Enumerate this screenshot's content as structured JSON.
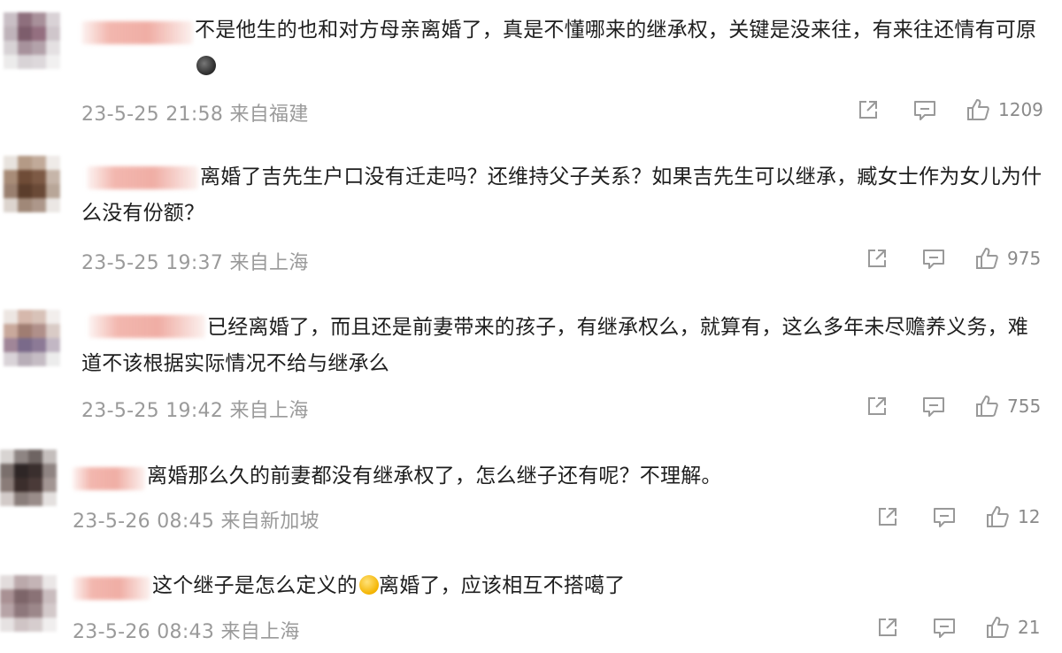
{
  "comments": [
    {
      "text": "不是他生的也和对方母亲离婚了，真是不懂哪来的继承权，关键是没来往，有来往还情有可原",
      "emoji": "dark",
      "time": "23-5-25 21:58",
      "location": "来自福建",
      "likes": "1209",
      "avatar": [
        "#c9bfc5",
        "#8e6f7d",
        "#a8909a",
        "#d9d2d6",
        "#bfb3ba",
        "#7d5d6c",
        "#946f80",
        "#cfc6cb",
        "#d7d2d5",
        "#a7929c",
        "#b3a2aa",
        "#e4e0e2",
        "#ecebeb",
        "#d8d3d6",
        "#ddd8db",
        "#f1f0f0"
      ]
    },
    {
      "text": "离婚了吉先生户口没有迁走吗？还维持父子关系？如果吉先生可以继承，臧女士作为女儿为什么没有份额？",
      "emoji": "",
      "time": "23-5-25 19:37",
      "location": "来自上海",
      "likes": "975",
      "avatar": [
        "#e8e3de",
        "#b49a86",
        "#c1aa99",
        "#efebe8",
        "#a88c78",
        "#6f4c37",
        "#7d5a45",
        "#c6b5a9",
        "#9a8070",
        "#5b3d2c",
        "#6a4a37",
        "#b8a698",
        "#dcd4ce",
        "#a08878",
        "#ad978a",
        "#ebe7e4"
      ]
    },
    {
      "text": "已经离婚了，而且还是前妻带来的孩子，有继承权么，就算有，这么多年未尽赡养义务，难道不该根据实际情况不给与继承么",
      "emoji": "",
      "time": "23-5-25 19:42",
      "location": "来自上海",
      "likes": "755",
      "avatar": [
        "#ede6e2",
        "#d6b8ac",
        "#d8c2b8",
        "#f2eeec",
        "#c9a99c",
        "#a07d72",
        "#b0908a",
        "#d9cbc6",
        "#a08698",
        "#7a6a8a",
        "#8c7a96",
        "#c2b7c4",
        "#d9d3d8",
        "#b8aeb8",
        "#c5bcc4",
        "#ececec"
      ]
    },
    {
      "text": "离婚那么久的前妻都没有继承权了，怎么继子还有呢？不理解。",
      "emoji": "",
      "time": "23-5-26 08:45",
      "location": "来自新加坡",
      "likes": "12",
      "avatar": [
        "#d8d4d2",
        "#8e8583",
        "#6e6462",
        "#c4bebc",
        "#7a6f6c",
        "#2e2626",
        "#3a2f2e",
        "#8f8482",
        "#8a7c78",
        "#3b2e2c",
        "#4a3a38",
        "#a29592",
        "#d2cac8",
        "#8a7e7b",
        "#998c89",
        "#e4e0df"
      ]
    },
    {
      "text": "这个继子是怎么定义的",
      "text2": "离婚了，应该相互不搭噶了",
      "emoji": "yellow",
      "time": "23-5-26 08:43",
      "location": "来自上海",
      "likes": "21",
      "avatar": [
        "#e2dcdc",
        "#bba9ab",
        "#c4b4b6",
        "#ebe7e7",
        "#a99194",
        "#7d6569",
        "#8a7276",
        "#c9bcbe",
        "#b6a3a6",
        "#8e787c",
        "#9c878a",
        "#d3c9ca",
        "#e6e2e2",
        "#cfc4c5",
        "#d6cdce",
        "#f0eeee"
      ]
    }
  ]
}
